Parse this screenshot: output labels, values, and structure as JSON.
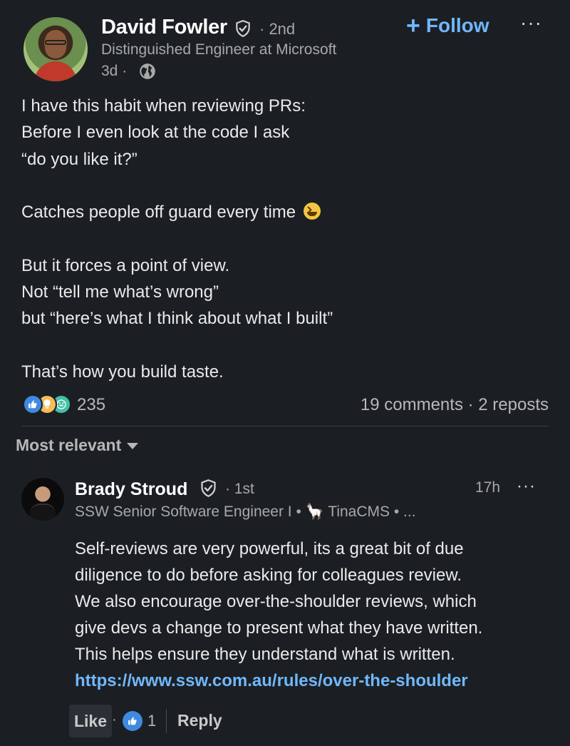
{
  "post": {
    "author": {
      "name": "David Fowler",
      "degree": "· 2nd",
      "headline": "Distinguished Engineer at Microsoft",
      "time": "3d ·"
    },
    "follow_label": "Follow",
    "more_label": "···",
    "body_lines": [
      "I have this habit when reviewing PRs:",
      "Before I even look at the code I ask",
      "“do you like it?”",
      "",
      "Catches people off guard every time",
      "",
      "But it forces a point of view.",
      "Not “tell me what’s wrong”",
      "but “here’s what I think about what I built”",
      "",
      "That’s how you build taste."
    ],
    "reaction_count": "235",
    "comments_stats": "19 comments · 2 reposts"
  },
  "sort_label": "Most relevant",
  "comment": {
    "name": "Brady Stroud",
    "degree": "· 1st",
    "headline": "SSW Senior Software Engineer I • 🦙 TinaCMS • ...",
    "time": "17h",
    "more_label": "···",
    "body_lines": [
      "Self-reviews are very powerful, its a great bit of due",
      "diligence to do before asking for colleagues review.",
      "We also encourage over-the-shoulder reviews, which",
      "give devs a change to present what they have written.",
      "This helps ensure they understand what is written."
    ],
    "link": "https://www.ssw.com.au/rules/over-the-shoulder",
    "like_label": "Like",
    "dot": "·",
    "like_count": "1",
    "reply_label": "Reply"
  },
  "colors": {
    "background": "#1b1f23",
    "accent_link": "#71b7fb",
    "like_reaction": "#3f8ae0"
  },
  "icons": [
    "verified-icon",
    "globe-icon",
    "plus-icon",
    "more-icon",
    "laugh-emoji-icon",
    "like-reaction-icon",
    "insightful-reaction-icon",
    "funny-reaction-icon",
    "caret-down-icon"
  ]
}
